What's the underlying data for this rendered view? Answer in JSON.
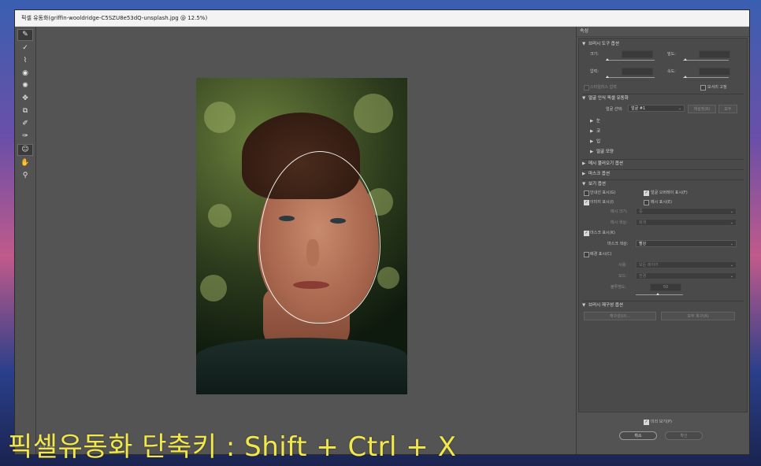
{
  "window": {
    "title": "픽셀 유동화(griffin-wooldridge-C5SZU8e53dQ-unsplash.jpg @ 12.5%)"
  },
  "toolbar": {
    "tools": [
      "forward-warp-icon",
      "reconstruct-icon",
      "smooth-icon",
      "twirl-icon",
      "pucker-icon",
      "bloat-icon",
      "push-left-icon",
      "freeze-mask-icon",
      "thaw-mask-icon",
      "face-tool-icon",
      "hand-icon",
      "zoom-icon"
    ]
  },
  "canvas": {
    "zoom_label": "12.5%"
  },
  "panel": {
    "header": "속성",
    "brush": {
      "title": "브러시 도구 옵션",
      "size_label": "크기:",
      "density_label": "밀도:",
      "pressure_label": "압력:",
      "rate_label": "속도:",
      "stylus_label": "스타일러스 압력",
      "pin_edges_label": "모서리 고정"
    },
    "face": {
      "title": "얼굴 인식 픽셀 유동화",
      "select_label": "얼굴 선택:",
      "select_value": "얼굴 #1",
      "reset_btn": "재설정(R)",
      "all_btn": "모두",
      "eyes": "눈",
      "nose": "코",
      "mouth": "입",
      "face_shape": "얼굴 모양"
    },
    "load_mesh": "메시 불러오기 옵션",
    "mask": "마스크 옵션",
    "view": {
      "title": "보기 옵션",
      "guides": "안내선 표시(G)",
      "face_overlay": "얼굴 오버레이 표시(F)",
      "image": "이미지 표시(I)",
      "mesh": "메시 표시(E)",
      "mesh_size_label": "메시 크기:",
      "mesh_size_value": "중",
      "mesh_color_label": "메시 색상:",
      "mesh_color_value": "회색",
      "show_mask": "마스크 표시(K)",
      "mask_color_label": "마스크 색상:",
      "mask_color_value": "빨강",
      "show_backdrop": "배경 표시(C)",
      "use_label": "사용:",
      "use_value": "모든 레이어",
      "mode_label": "모드:",
      "mode_value": "전경",
      "opacity_label": "불투명도:",
      "opacity_value": "50"
    },
    "reconstruct": {
      "title": "브러시 재구성 옵션",
      "reconstruct_btn": "재구성(U)...",
      "restore_btn": "모두 복구(A)"
    },
    "preview": "미리 보기(P)",
    "cancel": "취소",
    "ok": "확인"
  },
  "overlay": {
    "text": "픽셀유동화 단축키 : Shift + Ctrl + X"
  }
}
